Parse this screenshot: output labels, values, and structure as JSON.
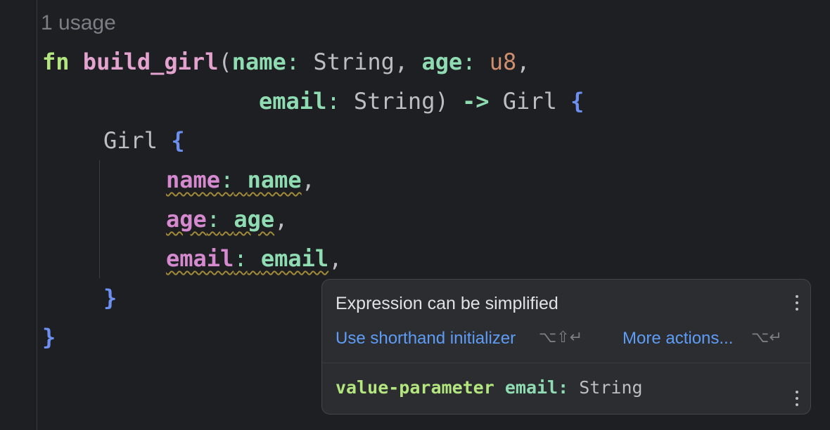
{
  "usage_hint": "1 usage",
  "code": {
    "line1": {
      "kw": "fn",
      "fn_name": "build_girl",
      "open_paren": "(",
      "p1_name": "name",
      "p1_colon": ":",
      "p1_type": "String",
      "comma1": ",",
      "p2_name": "age",
      "p2_colon": ":",
      "p2_type": "u8",
      "comma2": ","
    },
    "line2": {
      "p3_name": "email",
      "p3_colon": ":",
      "p3_type": "String",
      "close_paren": ")",
      "arrow": "->",
      "ret_type": "Girl",
      "brace": "{"
    },
    "line3": {
      "struct_name": "Girl",
      "brace": "{"
    },
    "fields": [
      {
        "field": "name",
        "colon": ":",
        "value": "name",
        "comma": ","
      },
      {
        "field": "age",
        "colon": ":",
        "value": "age",
        "comma": ","
      },
      {
        "field": "email",
        "colon": ":",
        "value": "email",
        "comma": ","
      }
    ],
    "inner_close": "}",
    "outer_close": "}"
  },
  "popup": {
    "title": "Expression can be simplified",
    "action_primary": "Use shorthand initializer",
    "action_primary_shortcut": "⌥⇧↵",
    "action_more": "More actions...",
    "action_more_shortcut": "⌥↵",
    "doc_keyword": "value-parameter",
    "doc_param": "email",
    "doc_colon": ":",
    "doc_type": "String"
  }
}
